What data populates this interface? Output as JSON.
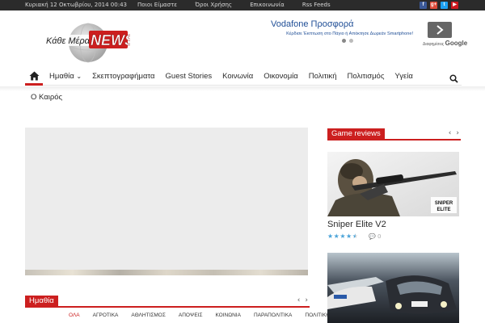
{
  "topbar": {
    "date": "Κυριακή 12 Οκτωβρίου, 2014 00:43",
    "links": [
      "Ποιοι Είμαστε",
      "Όροι Χρήσης",
      "Επικοινωνία",
      "Rss Feeds"
    ],
    "social": [
      {
        "icon": "facebook-icon",
        "glyph": "f",
        "color": "#3b5998"
      },
      {
        "icon": "google-plus-icon",
        "glyph": "g+",
        "color": "#dd4b39"
      },
      {
        "icon": "twitter-icon",
        "glyph": "t",
        "color": "#1da1f2"
      },
      {
        "icon": "youtube-icon",
        "glyph": "▶",
        "color": "#cc181e"
      }
    ]
  },
  "logo": {
    "prefix": "Κάθε Μέρα",
    "word": "NEWS"
  },
  "ad": {
    "title": "Vodafone Προσφορά",
    "subtitle": "Κέρδισε Έκπτωση στο Πάγιο ή Απόκτησε Δωρεάν Smartphone!",
    "google_prefix": "Διαφημίσεις",
    "google_word": "Google"
  },
  "nav": {
    "items": [
      "Ημαθία",
      "Σκεπτογραφήματα",
      "Guest Stories",
      "Κοινωνία",
      "Οικονομία",
      "Πολιτική",
      "Πολιτισμός",
      "Υγεία"
    ],
    "dropdown_marker": "⌄",
    "second_row": "Ο Καιρός"
  },
  "section_imathia": {
    "title": "Ημαθία",
    "categories": [
      "ΟΛΑ",
      "ΑΓΡΟΤΙΚΑ",
      "ΑΘΛΗΤΙΣΜΟΣ",
      "ΑΠΟΨΕΙΣ",
      "ΚΟΙΝΩΝΙΑ",
      "ΠΑΡΑΠΟΛΙΤΙΚΑ",
      "ΠΟΛΙΤΙΚΗ"
    ]
  },
  "game_reviews": {
    "title": "Game reviews",
    "post": {
      "title": "Sniper Elite V2",
      "rating": 4.5,
      "comments": "0",
      "logo_line1": "SNIPER",
      "logo_line2": "ELITE"
    }
  },
  "arrows": {
    "prev": "‹",
    "next": "›"
  }
}
